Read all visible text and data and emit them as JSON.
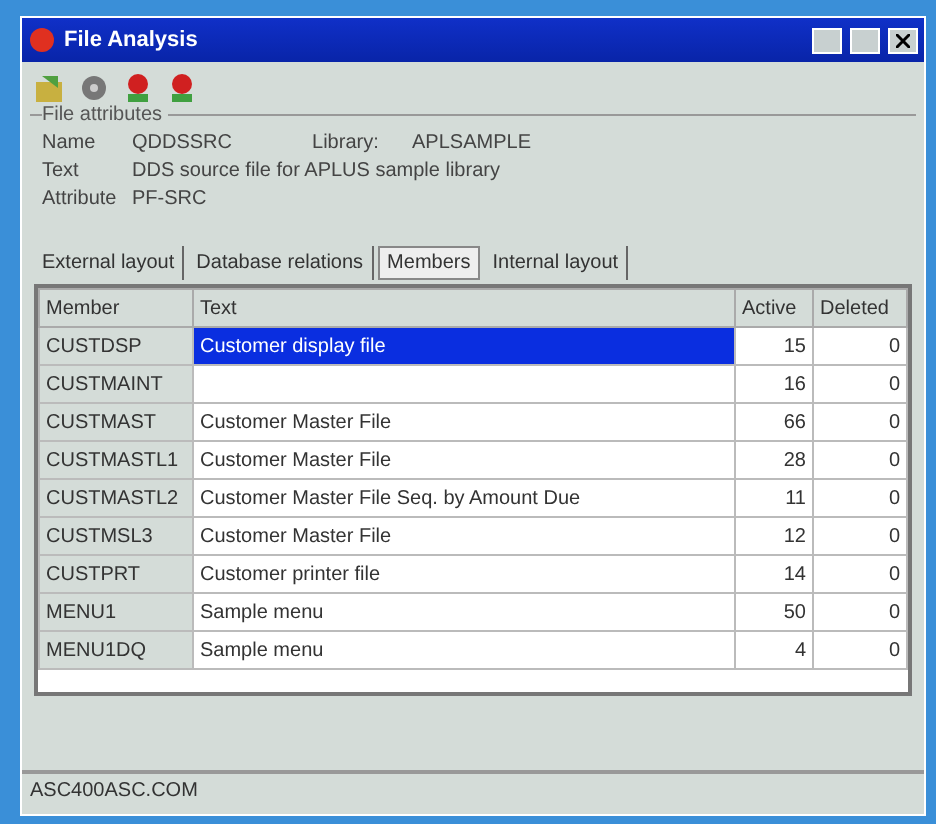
{
  "window": {
    "title": "File Analysis"
  },
  "toolbar": [
    {
      "kind": "folder"
    },
    {
      "kind": "gear"
    },
    {
      "kind": "flower"
    },
    {
      "kind": "flower"
    }
  ],
  "attributes": {
    "title": "File attributes",
    "fields": [
      {
        "label": "Name",
        "value": "QDDSSRC",
        "extra_label": "Library:",
        "extra_value": "APLSAMPLE"
      },
      {
        "label": "Text",
        "value": "DDS source file for APLUS sample library"
      },
      {
        "label": "Attribute",
        "value": "PF-SRC"
      }
    ]
  },
  "tabs": [
    {
      "label": "External layout",
      "selected": false
    },
    {
      "label": "Database relations",
      "selected": false
    },
    {
      "label": "Members",
      "selected": true
    },
    {
      "label": "Internal layout",
      "selected": false
    }
  ],
  "table": {
    "columns": [
      "Member",
      "Text",
      "Active",
      "Deleted"
    ],
    "rows": [
      {
        "cells": [
          "CUSTDSP",
          "Customer display file",
          "15",
          "0"
        ],
        "selected": true
      },
      {
        "cells": [
          "CUSTMAINT",
          "",
          "16",
          "0"
        ],
        "selected": false
      },
      {
        "cells": [
          "CUSTMAST",
          "Customer Master File",
          "66",
          "0"
        ],
        "selected": false
      },
      {
        "cells": [
          "CUSTMASTL1",
          "Customer Master File",
          "28",
          "0"
        ],
        "selected": false
      },
      {
        "cells": [
          "CUSTMASTL2",
          "Customer Master File Seq. by Amount Due",
          "11",
          "0"
        ],
        "selected": false
      },
      {
        "cells": [
          "CUSTMSL3",
          "Customer Master File",
          "12",
          "0"
        ],
        "selected": false
      },
      {
        "cells": [
          "CUSTPRT",
          "Customer printer file",
          "14",
          "0"
        ],
        "selected": false
      },
      {
        "cells": [
          "MENU1",
          "Sample menu",
          "50",
          "0"
        ],
        "selected": false
      },
      {
        "cells": [
          "MENU1DQ",
          "Sample menu",
          "4",
          "0"
        ],
        "selected": false
      }
    ]
  },
  "status_bar": "ASC400ASC.COM"
}
